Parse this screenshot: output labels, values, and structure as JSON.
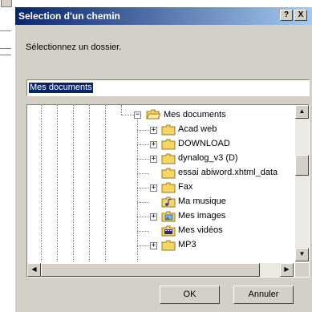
{
  "window": {
    "title": "Selection d'un chemin",
    "help_label": "?",
    "close_label": "X"
  },
  "prompt": "Sélectionnez un dossier.",
  "path_input": {
    "value": "Mes documents"
  },
  "tree": {
    "expand_symbol": "+",
    "collapse_symbol": "−",
    "root": {
      "label": "Mes documents",
      "expanded": true
    },
    "items": [
      {
        "label": "Acad web",
        "icon": "folder-icon",
        "expandable": true
      },
      {
        "label": "DOWNLOAD",
        "icon": "folder-icon",
        "expandable": true
      },
      {
        "label": "dynalog_v3 (D)",
        "icon": "folder-icon",
        "expandable": true
      },
      {
        "label": "essai abiword.xhtml_data",
        "icon": "folder-icon",
        "expandable": false
      },
      {
        "label": "Fax",
        "icon": "folder-icon",
        "expandable": true
      },
      {
        "label": "Ma musique",
        "icon": "music-folder-icon",
        "expandable": false
      },
      {
        "label": "Mes images",
        "icon": "pictures-folder-icon",
        "expandable": true
      },
      {
        "label": "Mes vidéos",
        "icon": "video-folder-icon",
        "expandable": false
      },
      {
        "label": "MP3",
        "icon": "folder-icon",
        "expandable": true
      }
    ]
  },
  "buttons": {
    "ok": "OK",
    "cancel": "Annuler"
  },
  "colors": {
    "titlebar_start": "#0a246a",
    "titlebar_end": "#a6caf0",
    "selection": "#0a246a",
    "face": "#d4d0c8",
    "folder": "#f3d66a"
  }
}
